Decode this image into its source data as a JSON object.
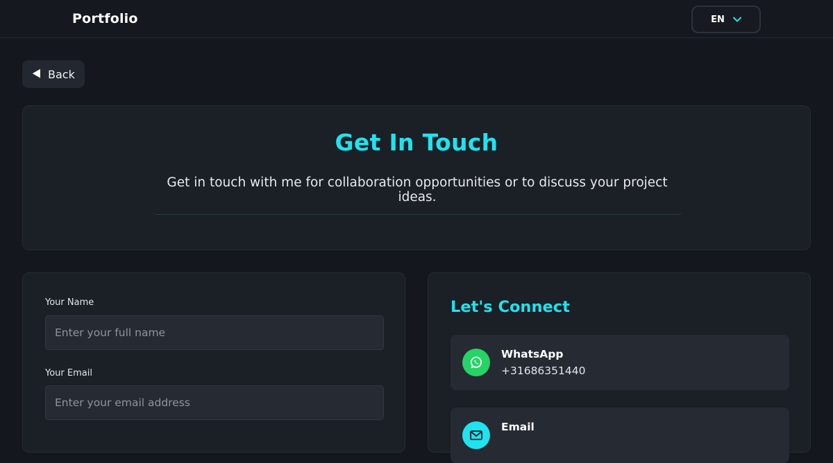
{
  "header": {
    "brand": "Portfolio",
    "language": "EN"
  },
  "back_button": {
    "label": "Back"
  },
  "hero": {
    "title": "Get In Touch",
    "subtitle": "Get in touch with me for collaboration opportunities or to discuss your project ideas."
  },
  "form": {
    "name_label": "Your Name",
    "name_placeholder": "Enter your full name",
    "name_value": "",
    "email_label": "Your Email",
    "email_placeholder": "Enter your email address",
    "email_value": ""
  },
  "connect": {
    "title": "Let's Connect",
    "items": [
      {
        "name": "WhatsApp",
        "value": "+31686351440",
        "icon": "whatsapp-icon",
        "color": "#25d366"
      },
      {
        "name": "Email",
        "value": "",
        "icon": "mail-icon",
        "color": "#1fe3ee"
      }
    ]
  },
  "colors": {
    "accent": "#1fe3ee",
    "background": "#14171d",
    "card": "#1b1f26",
    "input": "#262a33"
  }
}
